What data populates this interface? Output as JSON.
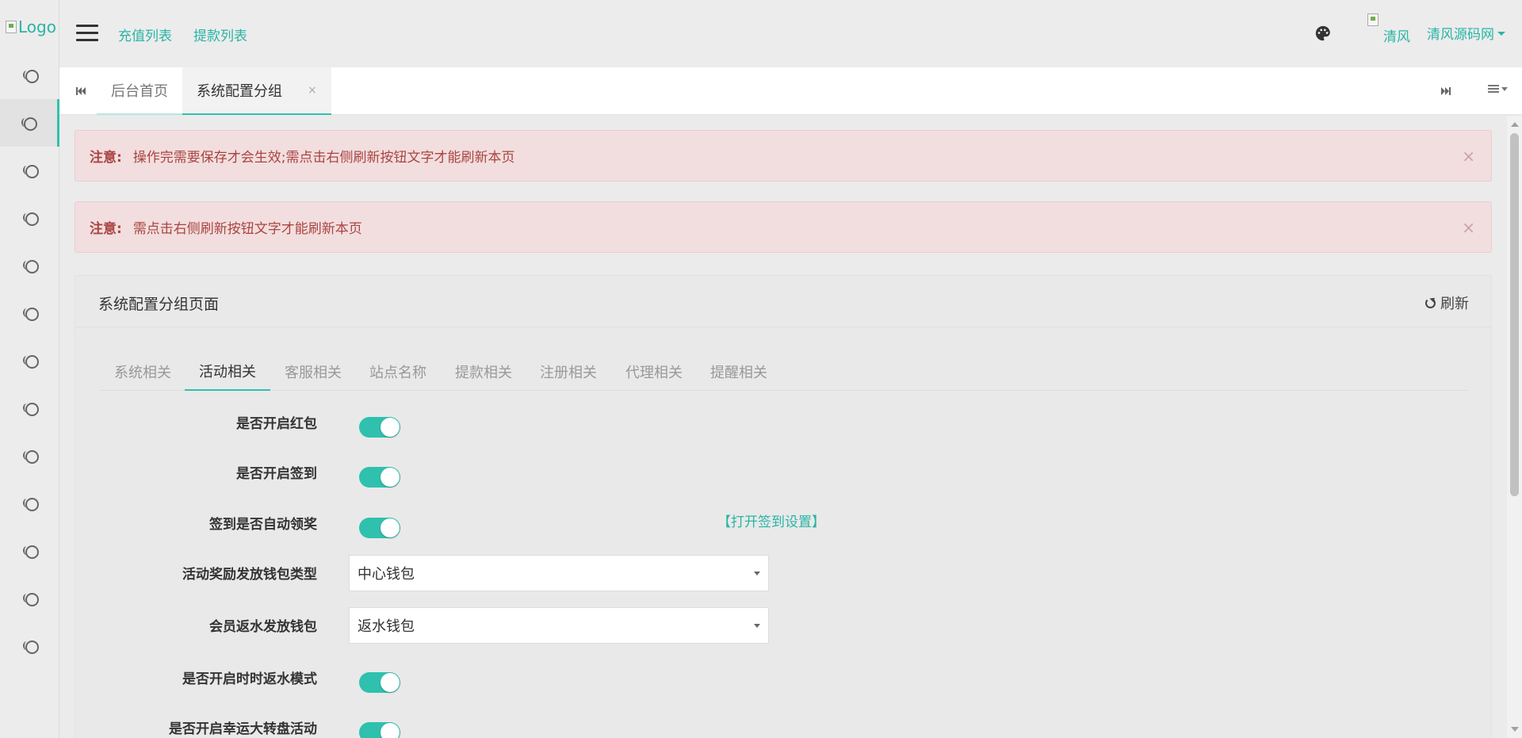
{
  "logo": {
    "alt": "Logo"
  },
  "header": {
    "links": [
      "充值列表",
      "提款列表"
    ],
    "avatar_alt": "清风",
    "user_name": "清风源码网"
  },
  "tabs": [
    {
      "label": "后台首页",
      "active": false
    },
    {
      "label": "系统配置分组",
      "active": true,
      "close": "×"
    }
  ],
  "alerts": [
    {
      "prefix": "注意:",
      "text": "操作完需要保存才会生效;需点击右侧刷新按钮文字才能刷新本页",
      "close": "×"
    },
    {
      "prefix": "注意:",
      "text": "需点击右侧刷新按钮文字才能刷新本页",
      "close": "×"
    }
  ],
  "panel": {
    "title": "系统配置分组页面",
    "refresh_label": "刷新"
  },
  "config_tabs": [
    "系统相关",
    "活动相关",
    "客服相关",
    "站点名称",
    "提款相关",
    "注册相关",
    "代理相关",
    "提醒相关"
  ],
  "config_tabs_active": "活动相关",
  "form": {
    "fields": [
      {
        "label": "是否开启红包",
        "type": "switch",
        "on": true
      },
      {
        "label": "是否开启签到",
        "type": "switch",
        "on": true
      },
      {
        "label": "签到是否自动领奖",
        "type": "switch",
        "on": true,
        "link": "【打开签到设置】"
      },
      {
        "label": "活动奖励发放钱包类型",
        "type": "select",
        "value": "中心钱包"
      },
      {
        "label": "会员返水发放钱包",
        "type": "select",
        "value": "返水钱包"
      },
      {
        "label": "是否开启时时返水模式",
        "type": "switch",
        "on": true
      },
      {
        "label": "是否开启幸运大转盘活动",
        "type": "switch",
        "on": true
      }
    ]
  },
  "colors": {
    "accent": "#2fc1ae",
    "link": "#29b5a5",
    "alert_bg": "#f2dede",
    "alert_text": "#a94442"
  }
}
